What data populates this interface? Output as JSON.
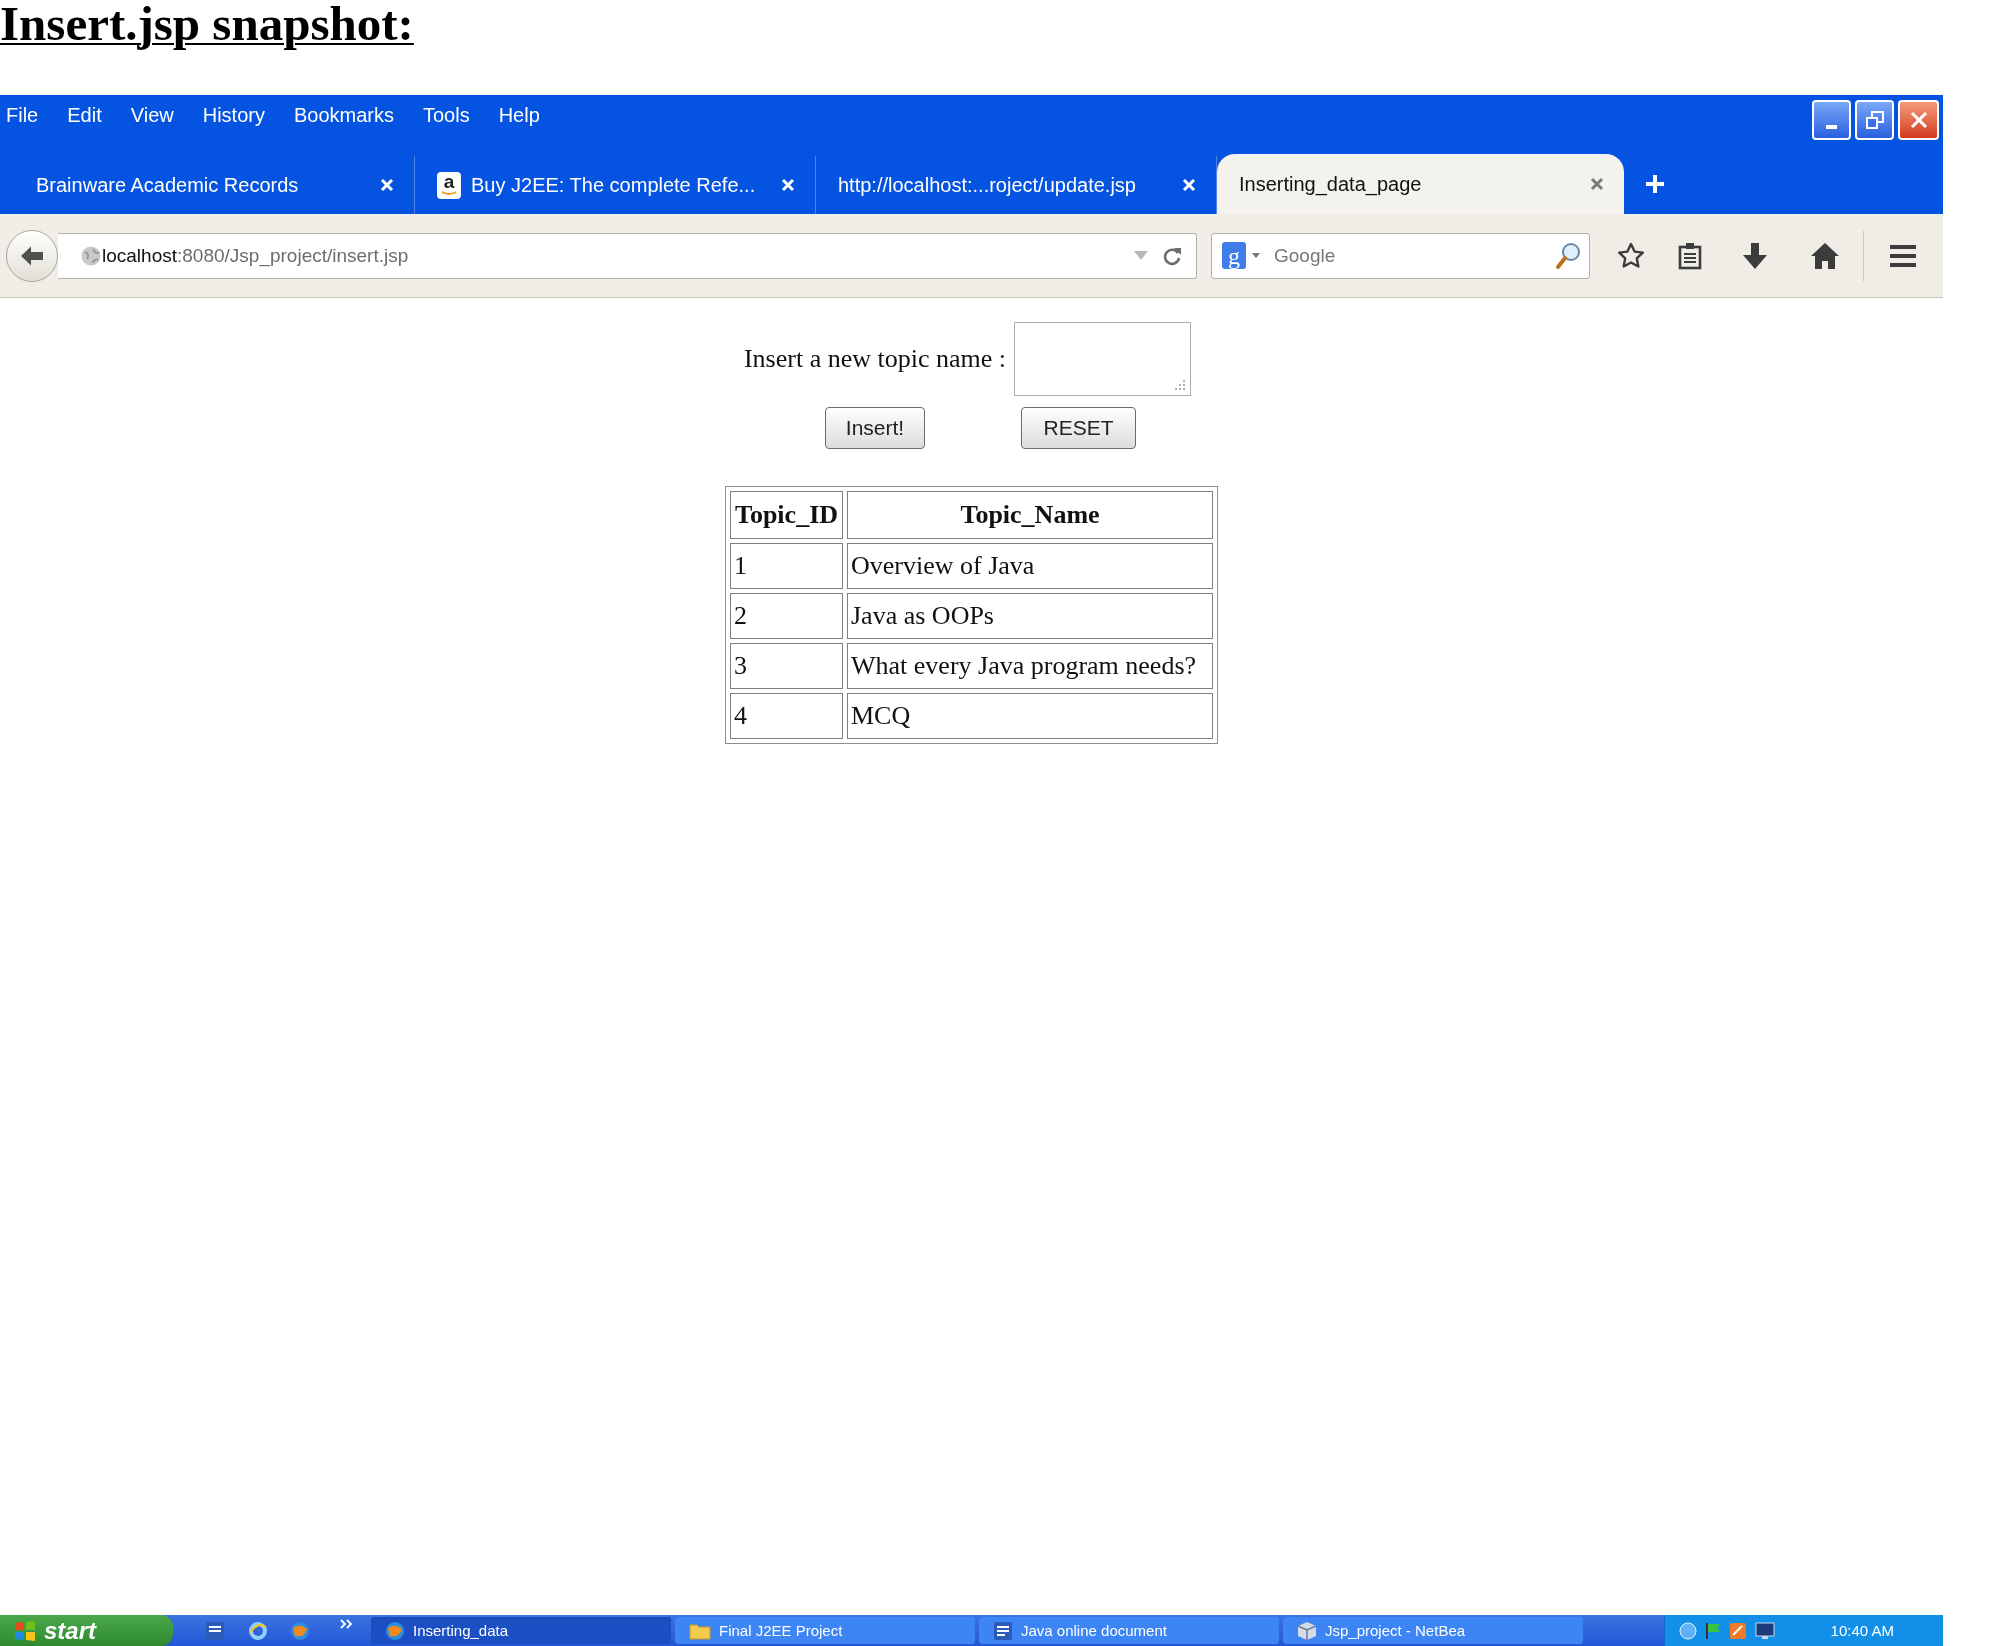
{
  "document_title": "Insert.jsp snapshot:",
  "browser": {
    "menu": [
      "File",
      "Edit",
      "View",
      "History",
      "Bookmarks",
      "Tools",
      "Help"
    ],
    "tabs": [
      {
        "title": "Brainware Academic Records",
        "selected": false
      },
      {
        "title": "Buy J2EE: The complete Refe...",
        "favicon_letter": "a",
        "selected": false
      },
      {
        "title": "http://localhost:...roject/update.jsp",
        "selected": false
      },
      {
        "title": "Inserting_data_page",
        "selected": true
      }
    ],
    "address_bar": {
      "host": "localhost",
      "path": ":8080/Jsp_project/insert.jsp"
    },
    "search": {
      "engine_letter": "g",
      "placeholder": "Google"
    }
  },
  "page": {
    "form": {
      "label": "Insert a new topic name :",
      "buttons": [
        "Insert!",
        "RESET"
      ]
    },
    "table": {
      "columns": [
        "Topic_ID",
        "Topic_Name"
      ],
      "rows": [
        [
          "1",
          "Overview of Java"
        ],
        [
          "2",
          "Java as OOPs"
        ],
        [
          "3",
          "What every Java program needs?"
        ],
        [
          "4",
          "MCQ"
        ]
      ]
    }
  },
  "taskbar": {
    "start_label": "start",
    "tasks": [
      {
        "label": "Inserting_data",
        "kind": "browser",
        "selected": true
      },
      {
        "label": "Final J2EE Project",
        "kind": "folder",
        "selected": false
      },
      {
        "label": "Java online document",
        "kind": "document",
        "selected": false
      },
      {
        "label": "Jsp_project - NetBea",
        "kind": "ide",
        "selected": false
      }
    ],
    "clock": "10:40 AM"
  }
}
